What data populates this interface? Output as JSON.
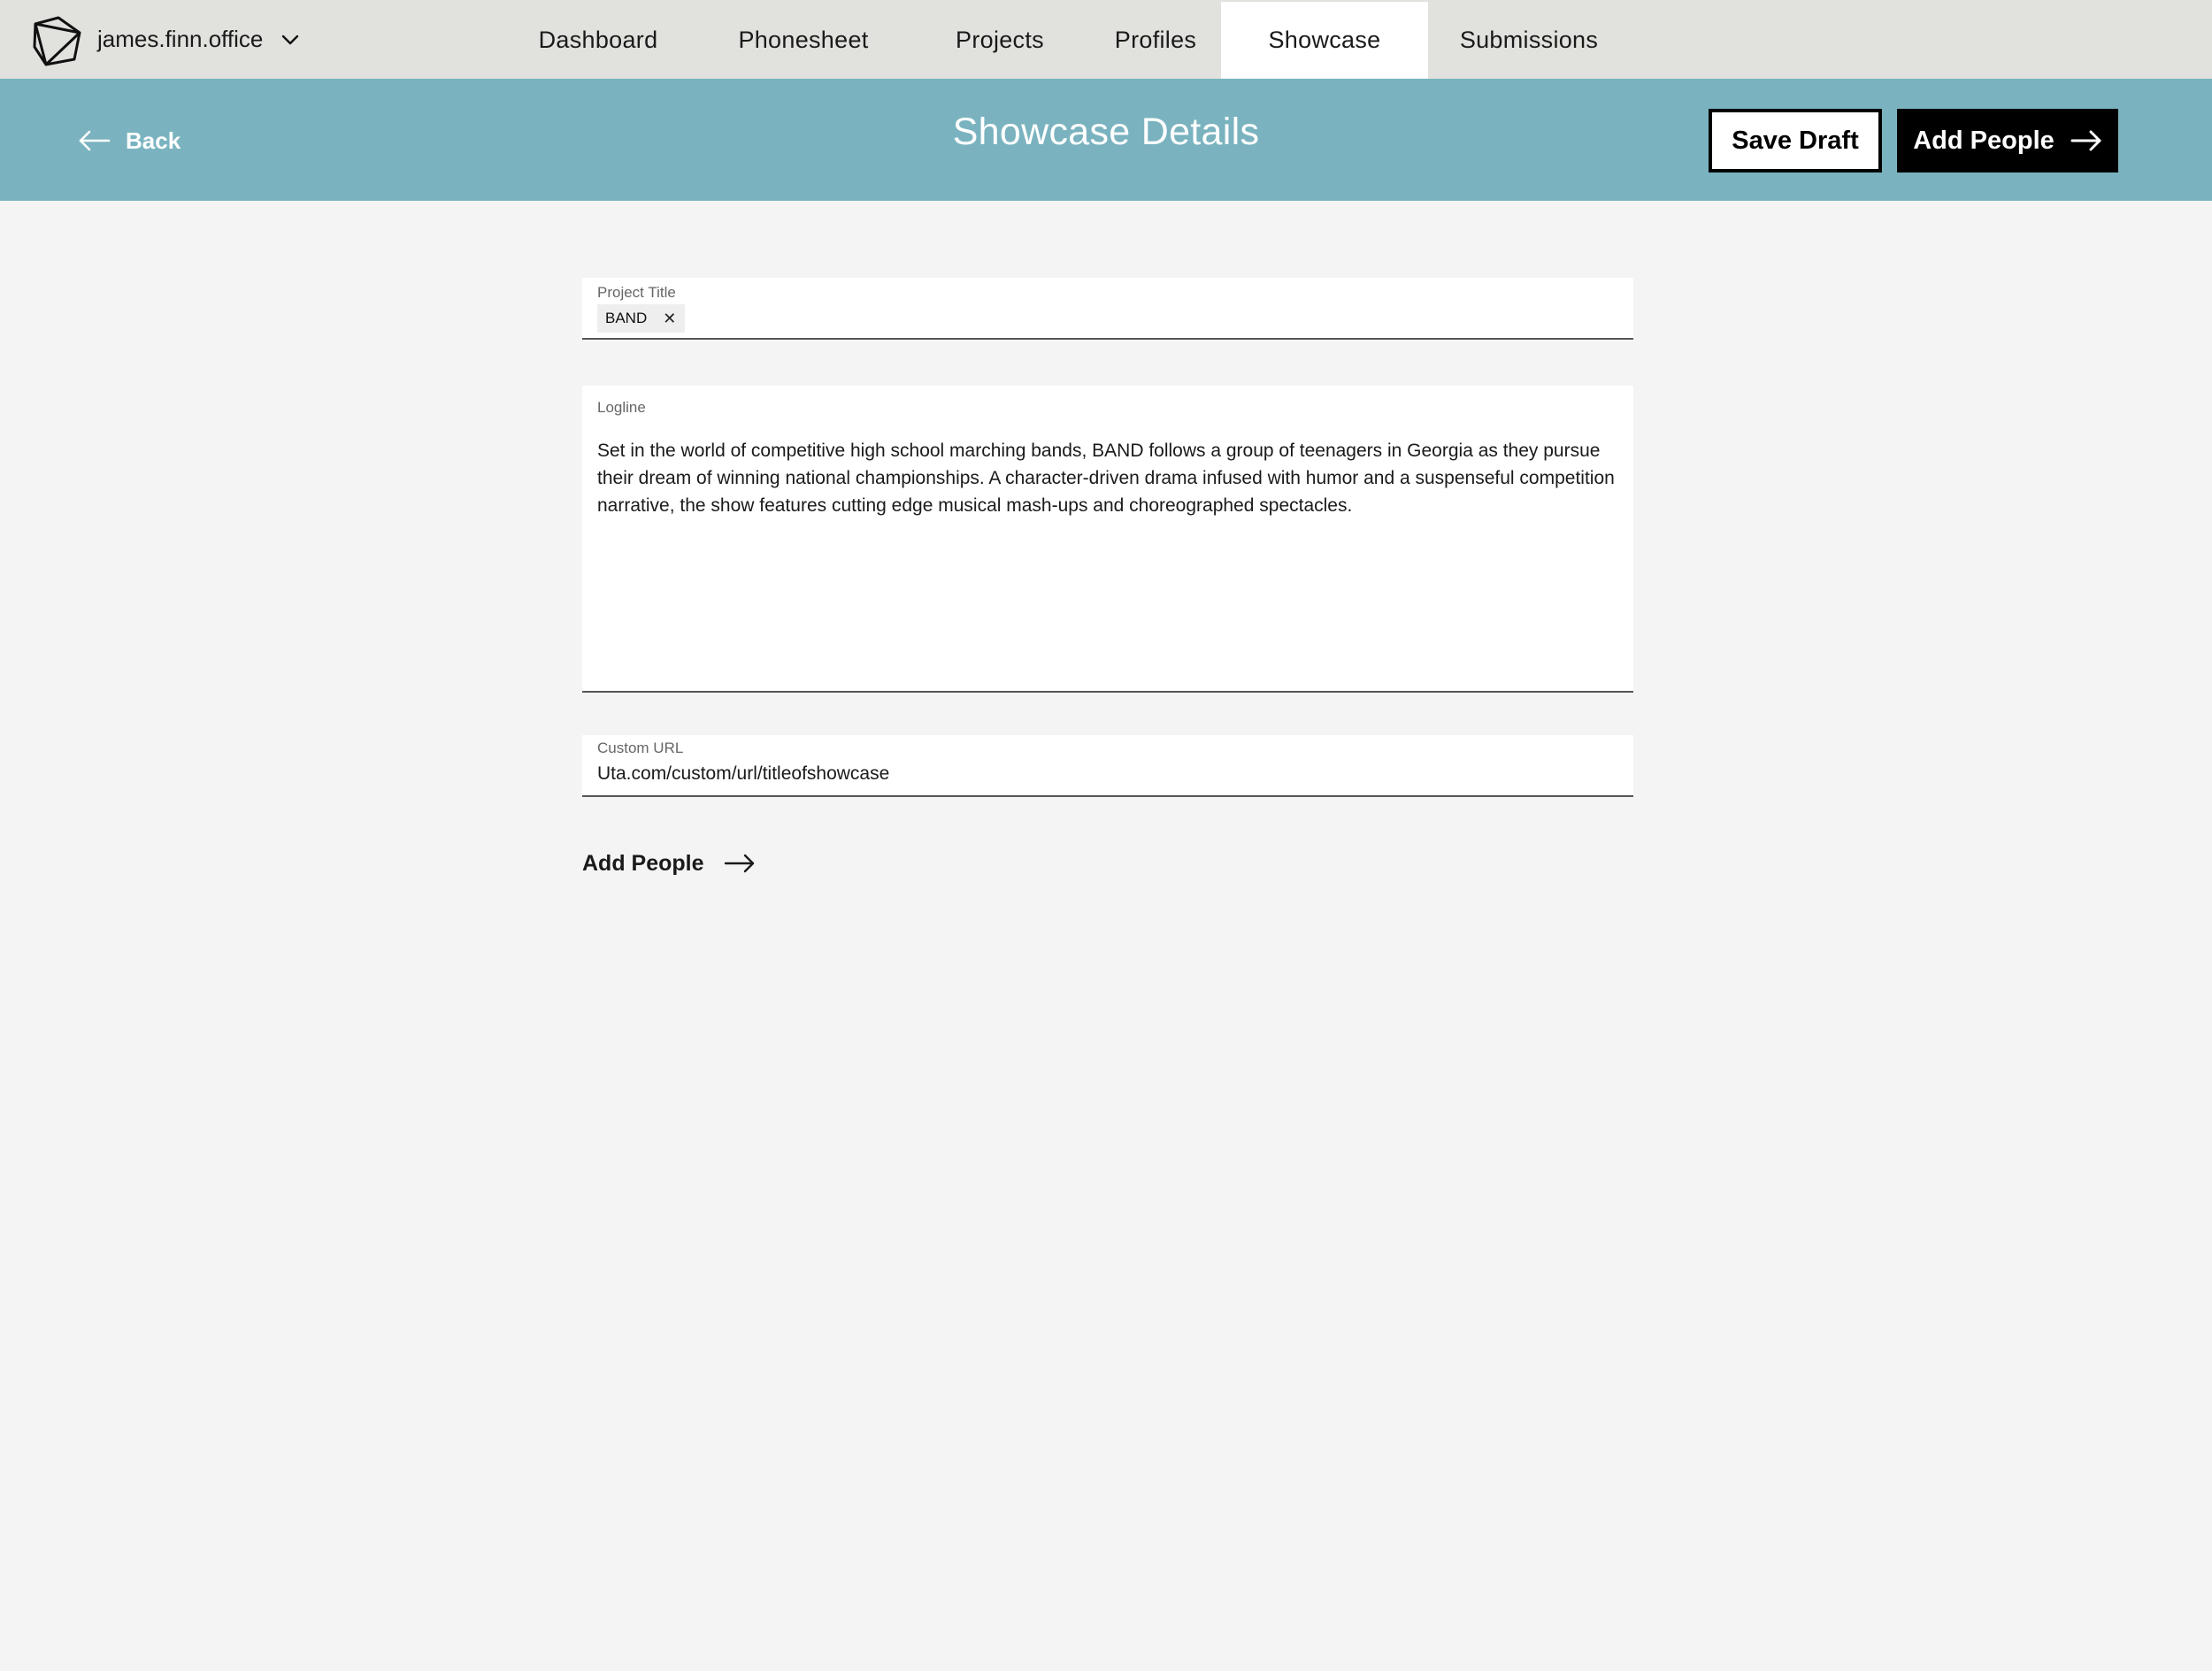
{
  "account": {
    "name": "james.finn.office",
    "logo_icon": "polyhedron-logo-icon",
    "dropdown_icon": "chevron-down-icon"
  },
  "nav": {
    "tabs": [
      {
        "label": "Dashboard",
        "active": false
      },
      {
        "label": "Phonesheet",
        "active": false
      },
      {
        "label": "Projects",
        "active": false
      },
      {
        "label": "Profiles",
        "active": false
      },
      {
        "label": "Showcase",
        "active": true
      },
      {
        "label": "Submissions",
        "active": false
      }
    ]
  },
  "header": {
    "back_label": "Back",
    "back_icon": "arrow-left-icon",
    "title": "Showcase Details",
    "save_draft_label": "Save Draft",
    "add_people_label": "Add People",
    "add_people_icon": "arrow-right-icon",
    "background_color": "#7ab3bf"
  },
  "form": {
    "project_title": {
      "label": "Project Title",
      "tag": "BAND",
      "remove_icon": "close-icon"
    },
    "logline": {
      "label": "Logline",
      "value": "Set in the world of competitive high school marching bands, BAND follows a group of teenagers in Georgia as they pursue their dream of winning national championships. A character-driven drama infused with humor and a suspenseful competition narrative, the show features cutting edge musical mash-ups and choreographed spectacles."
    },
    "custom_url": {
      "label": "Custom URL",
      "value": "Uta.com/custom/url/titleofshowcase"
    },
    "add_people_link": "Add People"
  }
}
